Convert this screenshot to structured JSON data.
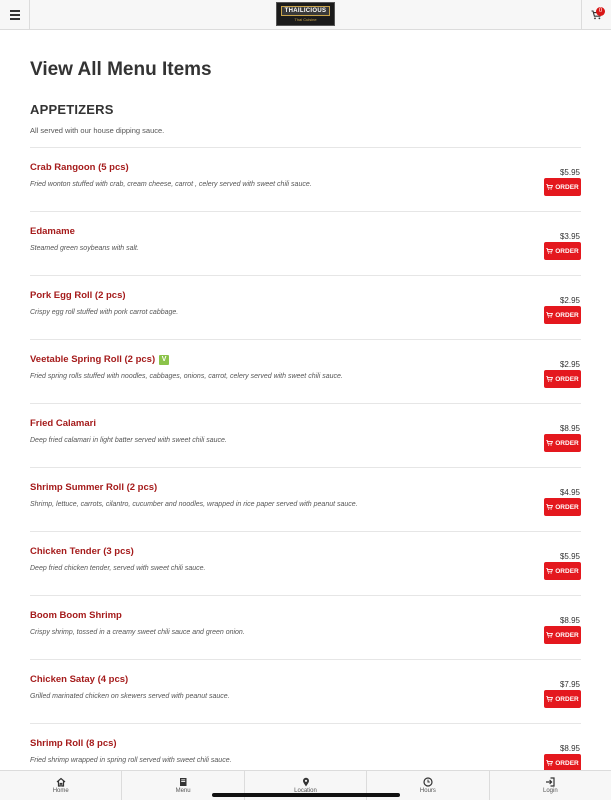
{
  "header": {
    "logo_text": "THAILICIOUS",
    "logo_sub": "Thai Cuisine",
    "cart_count": "0"
  },
  "page_title": "View All Menu Items",
  "section": {
    "title": "APPETIZERS",
    "description": "All served with our house dipping sauce."
  },
  "order_label": "ORDER",
  "veg_badge": "V",
  "items": [
    {
      "name": "Crab Rangoon (5 pcs)",
      "description": "Fried wonton stuffed with crab, cream cheese, carrot , celery served with sweet chili sauce.",
      "price": "$5.95",
      "vegetarian": false
    },
    {
      "name": "Edamame",
      "description": "Steamed green soybeans with salt.",
      "price": "$3.95",
      "vegetarian": false
    },
    {
      "name": "Pork Egg Roll (2 pcs)",
      "description": "Crispy egg roll stuffed with pork carrot cabbage.",
      "price": "$2.95",
      "vegetarian": false
    },
    {
      "name": "Veetable Spring Roll (2 pcs)",
      "description": "Fried spring rolls stuffed with noodles, cabbages, onions, carrot, celery served with sweet chili sauce.",
      "price": "$2.95",
      "vegetarian": true
    },
    {
      "name": "Fried Calamari",
      "description": "Deep fried calamari in light batter served with sweet chili sauce.",
      "price": "$8.95",
      "vegetarian": false
    },
    {
      "name": "Shrimp Summer Roll (2 pcs)",
      "description": "Shrimp, lettuce, carrots, cilantro, cucumber and noodles, wrapped in rice paper served with peanut sauce.",
      "price": "$4.95",
      "vegetarian": false
    },
    {
      "name": "Chicken Tender (3 pcs)",
      "description": "Deep fried chicken tender, served with sweet chili sauce.",
      "price": "$5.95",
      "vegetarian": false
    },
    {
      "name": "Boom Boom Shrimp",
      "description": "Crispy shrimp, tossed in a creamy sweet chili sauce and green onion.",
      "price": "$8.95",
      "vegetarian": false
    },
    {
      "name": "Chicken Satay (4 pcs)",
      "description": "Grilled marinated chicken on skewers served with peanut sauce.",
      "price": "$7.95",
      "vegetarian": false
    },
    {
      "name": "Shrimp Roll (8 pcs)",
      "description": "Fried shrimp wrapped in spring roll served with sweet chili sauce.",
      "price": "$8.95",
      "vegetarian": false
    }
  ],
  "bottom_nav": [
    {
      "label": "Home",
      "icon": "home-icon"
    },
    {
      "label": "Menu",
      "icon": "menu-book-icon"
    },
    {
      "label": "Location",
      "icon": "location-pin-icon"
    },
    {
      "label": "Hours",
      "icon": "clock-icon"
    },
    {
      "label": "Login",
      "icon": "login-icon"
    }
  ],
  "colors": {
    "accent": "#e4181e",
    "item_name": "#a51b1b",
    "veg_badge": "#8bc34a"
  }
}
